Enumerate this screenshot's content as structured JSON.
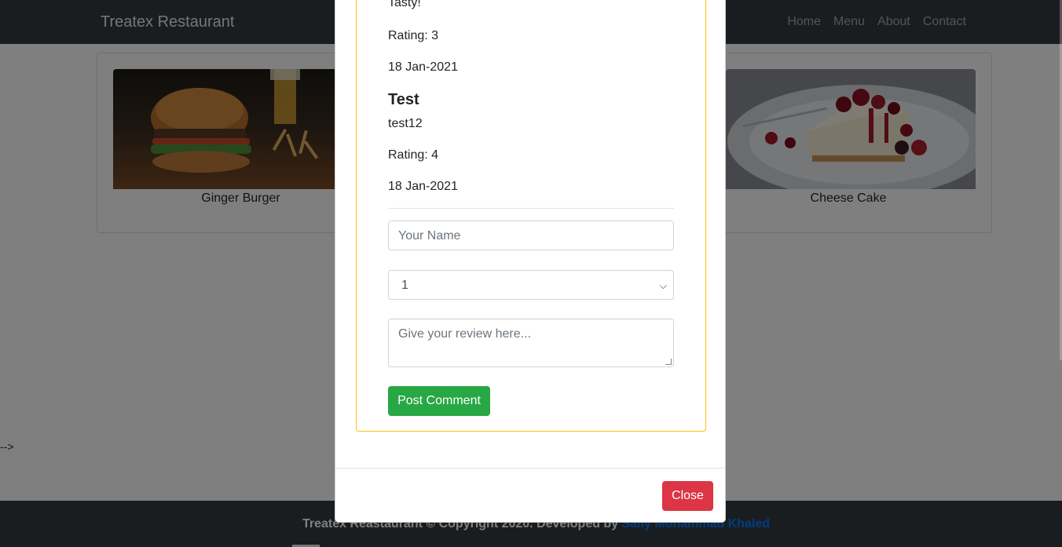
{
  "navbar": {
    "brand": "Treatex Restaurant",
    "links": [
      "Home",
      "Menu",
      "About",
      "Contact"
    ]
  },
  "menu_items": [
    {
      "name": "Ginger Burger",
      "image": "burger-photo"
    },
    {
      "name": "Cheese Cake",
      "image": "cheesecake-photo"
    }
  ],
  "stray_text": "-->",
  "footer": {
    "text": "Treatex Reastaurant © Copyright 2020. Developed by ",
    "developer": "Sally Mohammad Khaled"
  },
  "modal": {
    "reviews": [
      {
        "comment": "Tasty!",
        "rating": "Rating: 3",
        "date": "18 Jan-2021"
      },
      {
        "name": "Test",
        "comment": "test12",
        "rating": "Rating: 4",
        "date": "18 Jan-2021"
      }
    ],
    "form": {
      "name_placeholder": "Your Name",
      "rating_selected": "1",
      "review_placeholder": "Give your review here...",
      "submit_label": "Post Comment"
    },
    "close_label": "Close"
  },
  "colors": {
    "navbar_bg": "#343a40",
    "review_border": "#ffc107",
    "post_button": "#28a745",
    "close_button": "#dc3545",
    "developer_link": "#007bff"
  }
}
